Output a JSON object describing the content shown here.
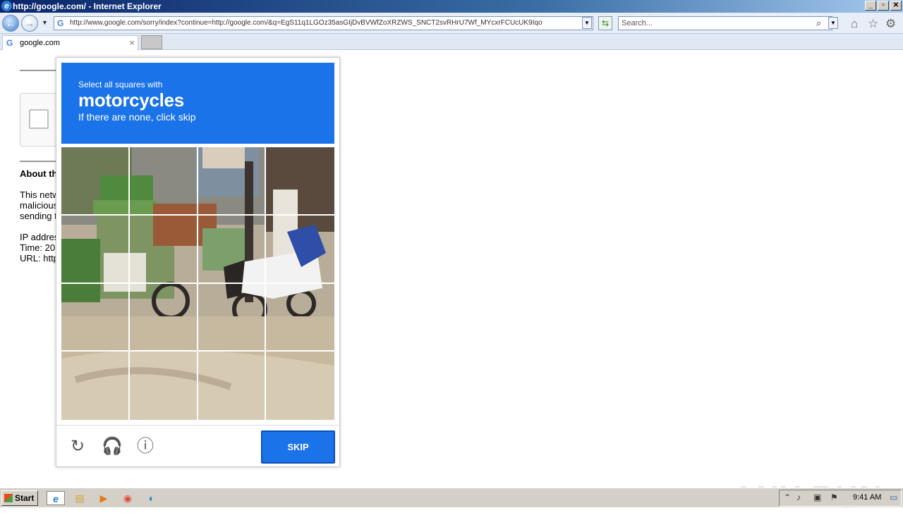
{
  "window": {
    "title": "http://google.com/ - Internet Explorer",
    "buttons": [
      "_",
      "▫",
      "✕"
    ]
  },
  "navbar": {
    "address": "http://www.google.com/sorry/index?continue=http://google.com/&q=EgS11q1LGOz35asGIjDvBVWfZoXRZWS_SNCT2svRHrU7Wf_MYcxrFCUcUK9Iqo",
    "search_placeholder": "Search..."
  },
  "tabs": [
    {
      "label": "google.com"
    }
  ],
  "page": {
    "about_heading": "About th",
    "paragraph_lines": [
      "This netw",
      "malicious",
      "sending t"
    ],
    "info_lines": [
      "IP addres",
      "Time: 20",
      "URL: http"
    ]
  },
  "captcha": {
    "instruction_small": "Select all squares with",
    "target": "motorcycles",
    "instruction_sub": "If there are none, click skip",
    "skip_label": "SKIP",
    "header_color": "#1a73e8"
  },
  "watermark": "ANY RUN",
  "taskbar": {
    "start_label": "Start",
    "clock": "9:41 AM"
  }
}
